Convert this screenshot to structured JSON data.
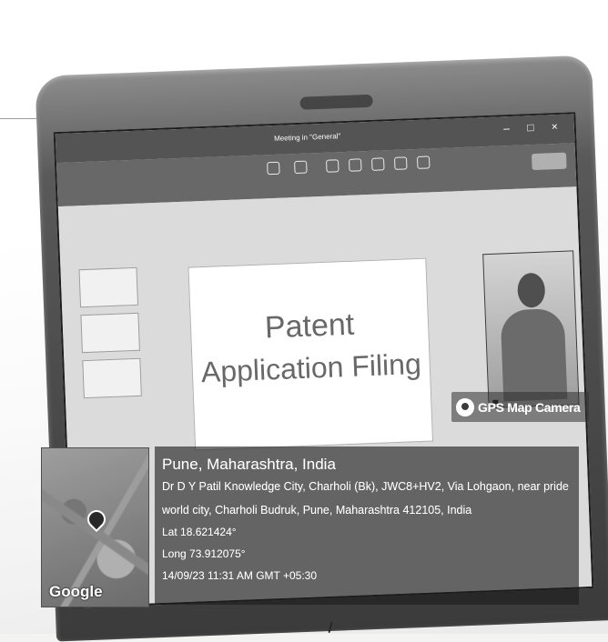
{
  "screen": {
    "window_title": "Meeting in \"General\"",
    "slide_title_line1": "Patent",
    "slide_title_line2": "Application Filing"
  },
  "overlay": {
    "brand": "GPS Map Camera",
    "map_logo": "Google",
    "location_title": "Pune, Maharashtra, India",
    "address_line1": "Dr D Y Patil Knowledge City, Charholi (Bk), JWC8+HV2, Via Lohgaon, near pride",
    "address_line2": "world city, Charholi Budruk, Pune, Maharashtra 412105, India",
    "latitude": "Lat 18.621424°",
    "longitude": "Long 73.912075°",
    "timestamp": "14/09/23 11:31 AM GMT +05:30"
  },
  "icons": {
    "brand_icon": "map-pin-camera-icon",
    "map_pin": "location-pin-icon"
  }
}
